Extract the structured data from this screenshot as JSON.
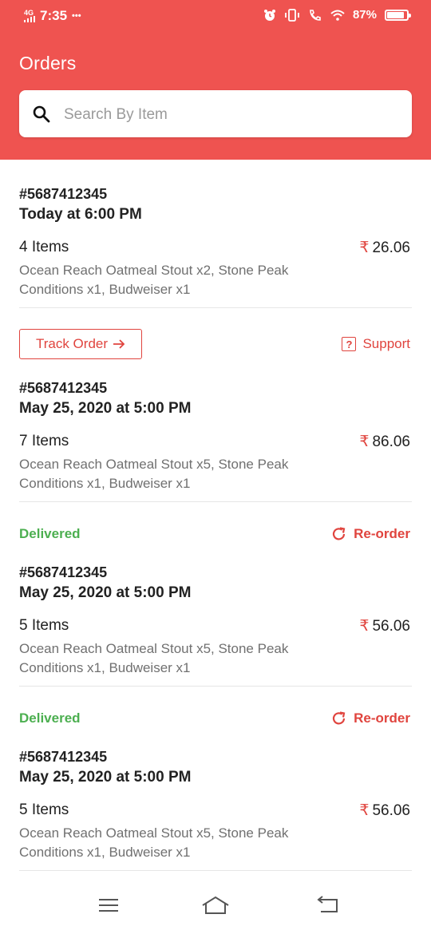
{
  "status_bar": {
    "network": "4G",
    "time": "7:35",
    "dots": "•••",
    "battery": "87%",
    "battery_level": 0.87
  },
  "header": {
    "title": "Orders",
    "search_placeholder": "Search By Item"
  },
  "orders": [
    {
      "id": "#5687412345",
      "date": "Today at 6:00 PM",
      "items_count": "4 Items",
      "currency": "₹",
      "price": "26.06",
      "items_desc": "Ocean Reach Oatmeal Stout x2, Stone Peak Conditions x1, Budweiser x1"
    },
    {
      "id": "#5687412345",
      "date": "May 25, 2020 at 5:00 PM",
      "items_count": "7 Items",
      "currency": "₹",
      "price": "86.06",
      "items_desc": "Ocean Reach Oatmeal Stout x5, Stone Peak Conditions x1, Budweiser x1"
    },
    {
      "id": "#5687412345",
      "date": "May 25, 2020 at 5:00 PM",
      "items_count": "5 Items",
      "currency": "₹",
      "price": "56.06",
      "items_desc": "Ocean Reach Oatmeal Stout x5, Stone Peak Conditions x1, Budweiser x1"
    },
    {
      "id": "#5687412345",
      "date": "May 25, 2020 at 5:00 PM",
      "items_count": "5 Items",
      "currency": "₹",
      "price": "56.06",
      "items_desc": "Ocean Reach Oatmeal Stout x5, Stone Peak Conditions x1, Budweiser x1"
    }
  ],
  "actions": {
    "track_order": "Track Order",
    "support": "Support",
    "delivered": "Delivered",
    "reorder": "Re-order"
  },
  "colors": {
    "primary": "#ef5350",
    "accent": "#e0443e",
    "delivered": "#4caf50"
  },
  "icons": {
    "search": "search-icon",
    "support": "question-box-icon",
    "reorder": "refresh-icon",
    "track": "arrow-right-icon",
    "nav_menu": "menu-icon",
    "nav_home": "home-icon",
    "nav_back": "back-icon"
  }
}
